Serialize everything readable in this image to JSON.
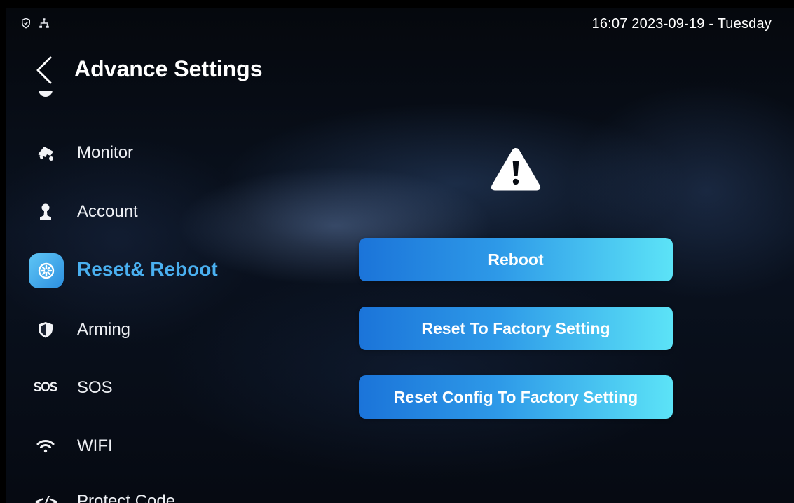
{
  "status_bar": {
    "icons": [
      "shield-check-icon",
      "network-icon"
    ],
    "clock": "16:07  2023-09-19 - Tuesday"
  },
  "header": {
    "back_icon": "chevron-left-icon",
    "title": "Advance Settings"
  },
  "sidebar": {
    "items": [
      {
        "label": "",
        "icon": "partial-item-icon"
      },
      {
        "label": "Monitor",
        "icon": "monitor-icon"
      },
      {
        "label": "Account",
        "icon": "person-icon"
      },
      {
        "label": "Reset& Reboot",
        "icon": "reset-reboot-icon",
        "active": true
      },
      {
        "label": "Arming",
        "icon": "shield-icon"
      },
      {
        "label": "SOS",
        "icon": "sos-icon",
        "icon_text": "SOS"
      },
      {
        "label": "WIFI",
        "icon": "wifi-icon"
      },
      {
        "label": "Protect Code",
        "icon": "code-icon",
        "icon_text": "</>"
      }
    ]
  },
  "main": {
    "warning_icon": "warning-triangle-icon",
    "buttons": {
      "reboot": "Reboot",
      "reset_factory": "Reset To Factory Setting",
      "reset_config": "Reset Config To Factory Setting"
    }
  },
  "colors": {
    "accent": "#4ab0f0",
    "button_gradient_start": "#1b74d9",
    "button_gradient_end": "#5ce3f7",
    "background": "#070b12"
  }
}
